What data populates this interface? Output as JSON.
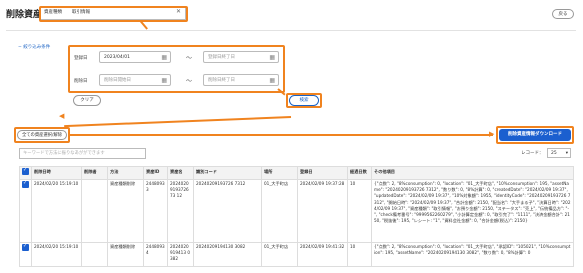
{
  "page": {
    "title": "削除資産情報",
    "back_label": "戻る",
    "selected_category_a": "資産種類",
    "selected_category_b": "取引情報"
  },
  "filters": {
    "toggle_label": "− 絞り込み条件",
    "registered_label": "登録日",
    "registered_start_value": "2023/04/01",
    "registered_end_placeholder": "登録日終了日",
    "deleted_label": "削除日",
    "deleted_start_placeholder": "削除日開始日",
    "deleted_end_placeholder": "削除日終了日",
    "tilde": "〜",
    "clear_label": "クリア",
    "search_label": "検索"
  },
  "actions": {
    "select_all_label": "全ての資産選択/解除",
    "download_label": "削除資産情報ダウンロード",
    "keyword_placeholder": "キーワードで方法に振りなあがができます",
    "records_label": "レコード：",
    "records_value": "25"
  },
  "table": {
    "headers": [
      "",
      "削除日時",
      "削除者",
      "方法",
      "資産ID",
      "資産名",
      "識別コード",
      "場所",
      "登録日",
      "経過日数",
      "その他項目"
    ],
    "rows": [
      {
        "deleted_at": "2024/02/20 15:19:10",
        "deleted_by": "",
        "method": "資産種類削除",
        "asset_id": "24480933",
        "asset_name": "2024020919372673 12",
        "code": "20240209193726 7312",
        "location": "01_大手町店",
        "registered": "2024/02/09 19:37:28",
        "elapsed": "10",
        "extra": "{\"点数\": 2, \"8%consumption\": 0, \"location\": \"01_大手町店\", \"10%consumption\": 195, \"assetName\": \"20240209193726 7312\", \"数り数\": 0, \"8%計算\": 0, \"createdDate\": \"2024/02/09 19:37\", \"updatedDate\": \"2024/02/09 19:37\", \"10%対象額\": 1955, \"identityCode\": \"20240209193726 7312\", \"開始日時\": \"2024/02/09 19:37\", \"合計金額\": 2150, \"配当名\": \"大手まる子\", \"決算日時\": \"2024/02/09 19:37\", \"資産種類\": \"取引情報\", \"お預り金額\": 2150, \"ステータス\": \"売上\", \"伝統備品方\": \"-\", \"check備考番号\": \"9999562260279\", \"小計算定金額\": 0, \"取引完了\": \"1111\", \"決済金額合計\": 2150, \"税抜後\": 195, \"レシート: \"1\", \"資料会社金額\": 0, \"合計金額(税込)\": 2150}"
      },
      {
        "deleted_at": "2024/02/20 15:19:10",
        "deleted_by": "",
        "method": "資産種類削除",
        "asset_id": "24480934",
        "asset_name": "2024020919413 0382",
        "code": "20240209194130 3082",
        "location": "01_大手町店",
        "registered": "2024/02/09 19:41:32",
        "elapsed": "10",
        "extra": "{\"点数\": 2, \"8%consumption\": 0, \"location\": \"01_大手町店\", \"承認ID\": \"105021\", \"10%consumption\": 195, \"assetName\": \"20240209194130 3082\", \"数り数\": 0, \"8%計算\": 0"
      }
    ]
  },
  "colors": {
    "accent": "#1b5fcf",
    "annotation": "#f0831f"
  }
}
